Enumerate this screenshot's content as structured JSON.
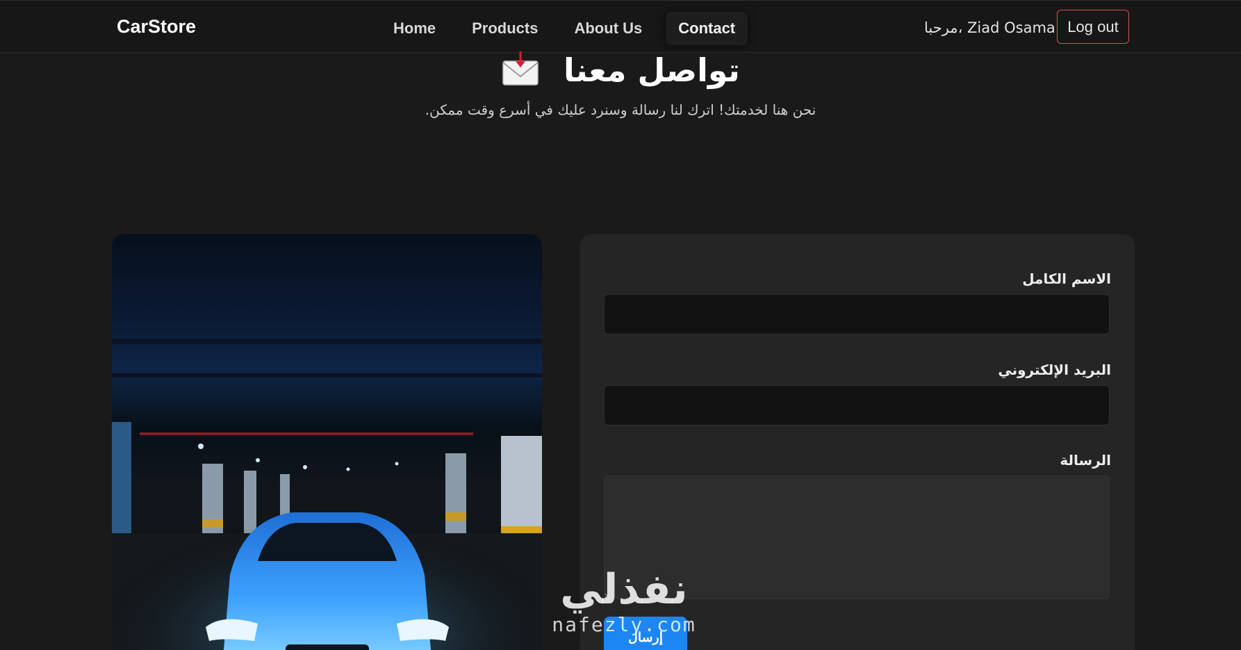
{
  "brand": "CarStore",
  "nav": [
    {
      "label": "Home",
      "active": false
    },
    {
      "label": "Products",
      "active": false
    },
    {
      "label": "About Us",
      "active": false
    },
    {
      "label": "Contact",
      "active": true
    }
  ],
  "user": {
    "greeting": "مرحبا، Ziad Osama",
    "logout_label": "Log out"
  },
  "hero": {
    "title": "تواصل معنا",
    "icon": "envelope-download-icon",
    "subtitle": "نحن هنا لخدمتك! اترك لنا رسالة وسنرد عليك في أسرع وقت ممكن."
  },
  "image_card": {
    "icon": "blue-car-photo"
  },
  "form": {
    "name_label": "الاسم الكامل",
    "name_value": "",
    "email_label": "البريد الإلكتروني",
    "email_value": "",
    "message_label": "الرسالة",
    "message_value": "",
    "submit_label": "إرسال"
  },
  "watermark": {
    "arabic": "نفذلي",
    "latin": "nafezly.com"
  },
  "colors": {
    "background": "#1a1a1a",
    "navbar": "#171717",
    "panel": "#252525",
    "input": "#121212",
    "logout_border": "#d9534f",
    "submit": "#1c86f2"
  }
}
